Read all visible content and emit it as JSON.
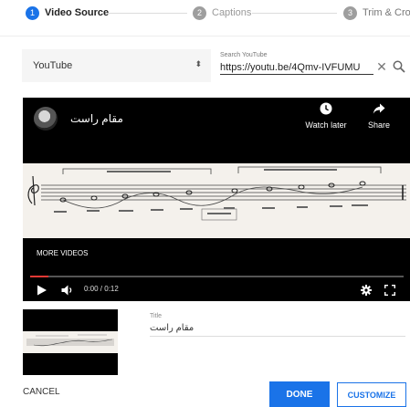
{
  "stepper": {
    "steps": [
      {
        "number": "1",
        "label": "Video Source",
        "active": true
      },
      {
        "number": "2",
        "label": "Captions",
        "active": false
      },
      {
        "number": "3",
        "label": "Trim & Crop",
        "active": false
      }
    ]
  },
  "source": {
    "selected": "YouTube",
    "caret_glyph": "⬍"
  },
  "search": {
    "label": "Search YouTube",
    "value": "https://youtu.be/4Qmv-IVFUMU",
    "clear_glyph": "✕"
  },
  "player": {
    "video_title": "مقام راست",
    "watch_later_label": "Watch later",
    "share_label": "Share",
    "more_videos_label": "MORE VIDEOS",
    "time_display": "0:00 / 0:12",
    "progress_fraction": 0.05
  },
  "details": {
    "title_label": "Title",
    "title_value": "مقام راست"
  },
  "footer": {
    "cancel_label": "CANCEL",
    "done_label": "DONE",
    "customize_label": "CUSTOMIZE"
  },
  "colors": {
    "accent": "#1a73e8",
    "progress": "#e53935",
    "player_bg": "#000000",
    "inactive_step": "#9e9e9e"
  },
  "icons": {
    "source_caret": "caret-updown-icon",
    "clear": "close-icon",
    "search": "search-icon",
    "watch_later": "clock-icon",
    "share": "share-arrow-icon",
    "play": "play-icon",
    "volume": "volume-icon",
    "settings": "gear-icon",
    "fullscreen": "fullscreen-icon"
  }
}
